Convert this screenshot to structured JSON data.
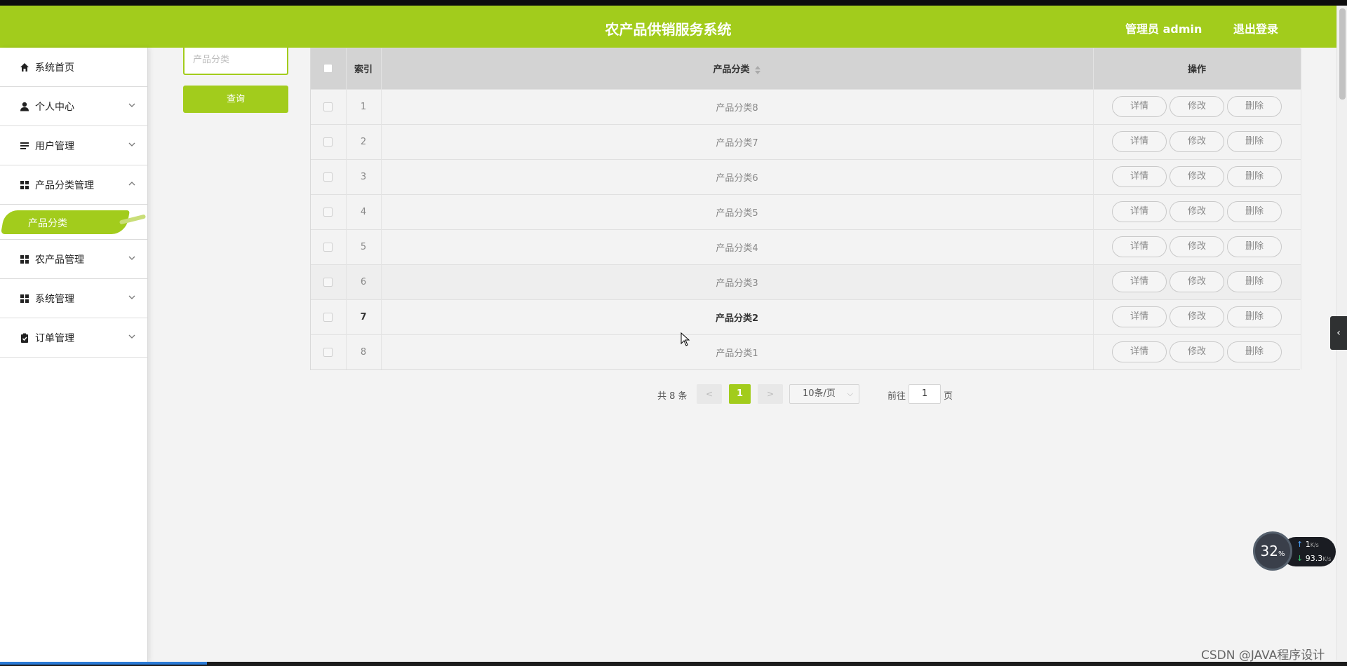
{
  "header": {
    "title": "农产品供销服务系统",
    "user": "管理员 admin",
    "logout": "退出登录"
  },
  "sidebar": {
    "items": [
      {
        "label": "系统首页",
        "icon": "home-icon"
      },
      {
        "label": "个人中心",
        "icon": "user-icon"
      },
      {
        "label": "用户管理",
        "icon": "list-icon"
      },
      {
        "label": "产品分类管理",
        "icon": "grid-icon"
      },
      {
        "label": "农产品管理",
        "icon": "grid-icon"
      },
      {
        "label": "系统管理",
        "icon": "grid-icon"
      },
      {
        "label": "订单管理",
        "icon": "clipboard-icon"
      }
    ],
    "active_sub": "产品分类"
  },
  "search": {
    "placeholder": "产品分类",
    "button": "查询"
  },
  "table": {
    "headers": {
      "index": "索引",
      "category": "产品分类",
      "actions": "操作"
    },
    "rows": [
      {
        "index": "1",
        "category": "产品分类8"
      },
      {
        "index": "2",
        "category": "产品分类7"
      },
      {
        "index": "3",
        "category": "产品分类6"
      },
      {
        "index": "4",
        "category": "产品分类5"
      },
      {
        "index": "5",
        "category": "产品分类4"
      },
      {
        "index": "6",
        "category": "产品分类3"
      },
      {
        "index": "7",
        "category": "产品分类2"
      },
      {
        "index": "8",
        "category": "产品分类1"
      }
    ],
    "actions": {
      "detail": "详情",
      "edit": "修改",
      "delete": "删除"
    }
  },
  "pagination": {
    "total": "共 8 条",
    "prev": "<",
    "current": "1",
    "next": ">",
    "page_size": "10条/页",
    "goto_label": "前往",
    "goto_value": "1",
    "page_unit": "页"
  },
  "speed_widget": {
    "percent": "32",
    "percent_unit": "%",
    "upload": "1",
    "download": "93.3",
    "unit": "K/s"
  },
  "watermark": "CSDN @JAVA程序设计",
  "colors": {
    "accent": "#a2cc1c",
    "background": "#f3f3f3"
  }
}
